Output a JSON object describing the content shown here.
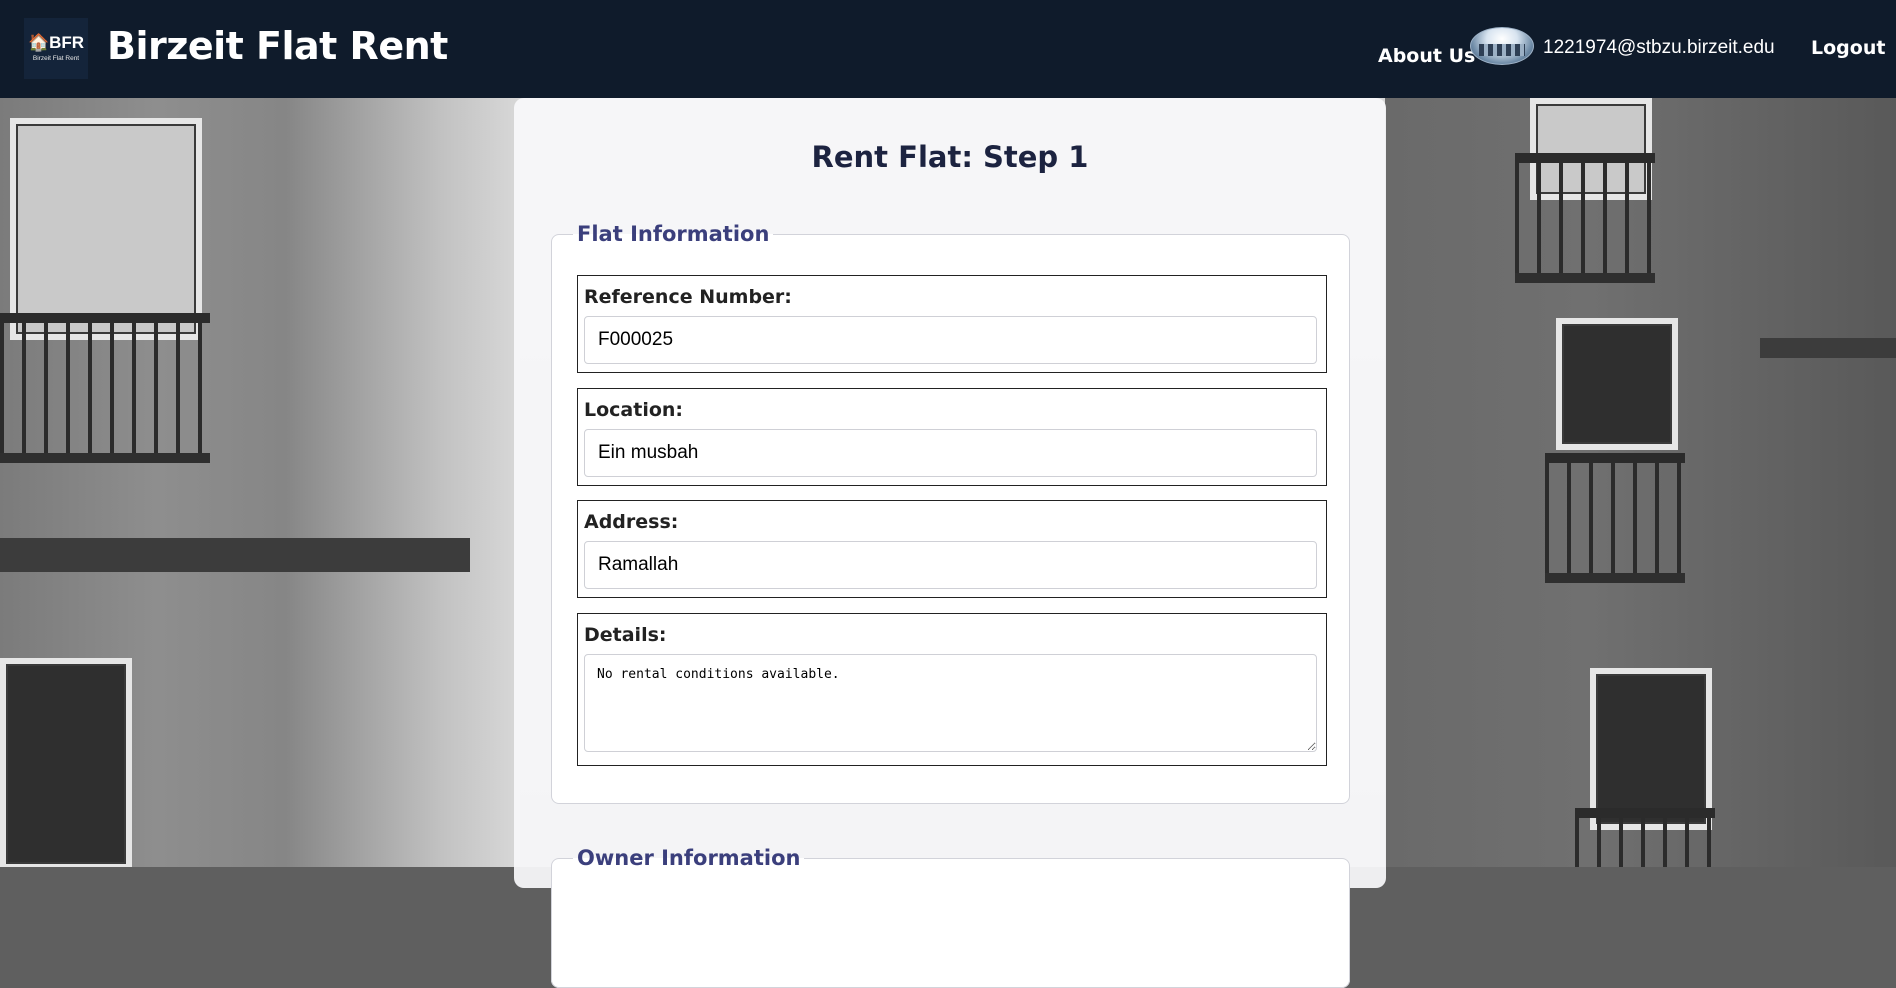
{
  "header": {
    "logo_mark": "🏠BFR",
    "logo_sub": "Birzeit Flat Rent",
    "site_title": "Birzeit Flat Rent",
    "nav_about": "About Us",
    "user_email": "1221974@stbzu.birzeit.edu",
    "logout": "Logout"
  },
  "page": {
    "title": "Rent Flat: Step 1"
  },
  "flat_info": {
    "legend": "Flat Information",
    "reference_label": "Reference Number:",
    "reference_value": "F000025",
    "location_label": "Location:",
    "location_value": "Ein musbah",
    "address_label": "Address:",
    "address_value": "Ramallah",
    "details_label": "Details:",
    "details_value": "No rental conditions available."
  },
  "owner_info": {
    "legend": "Owner Information"
  },
  "colors": {
    "header_bg": "#0f1b2b",
    "title_text": "#1c2340",
    "legend_text": "#3b3f7c"
  }
}
